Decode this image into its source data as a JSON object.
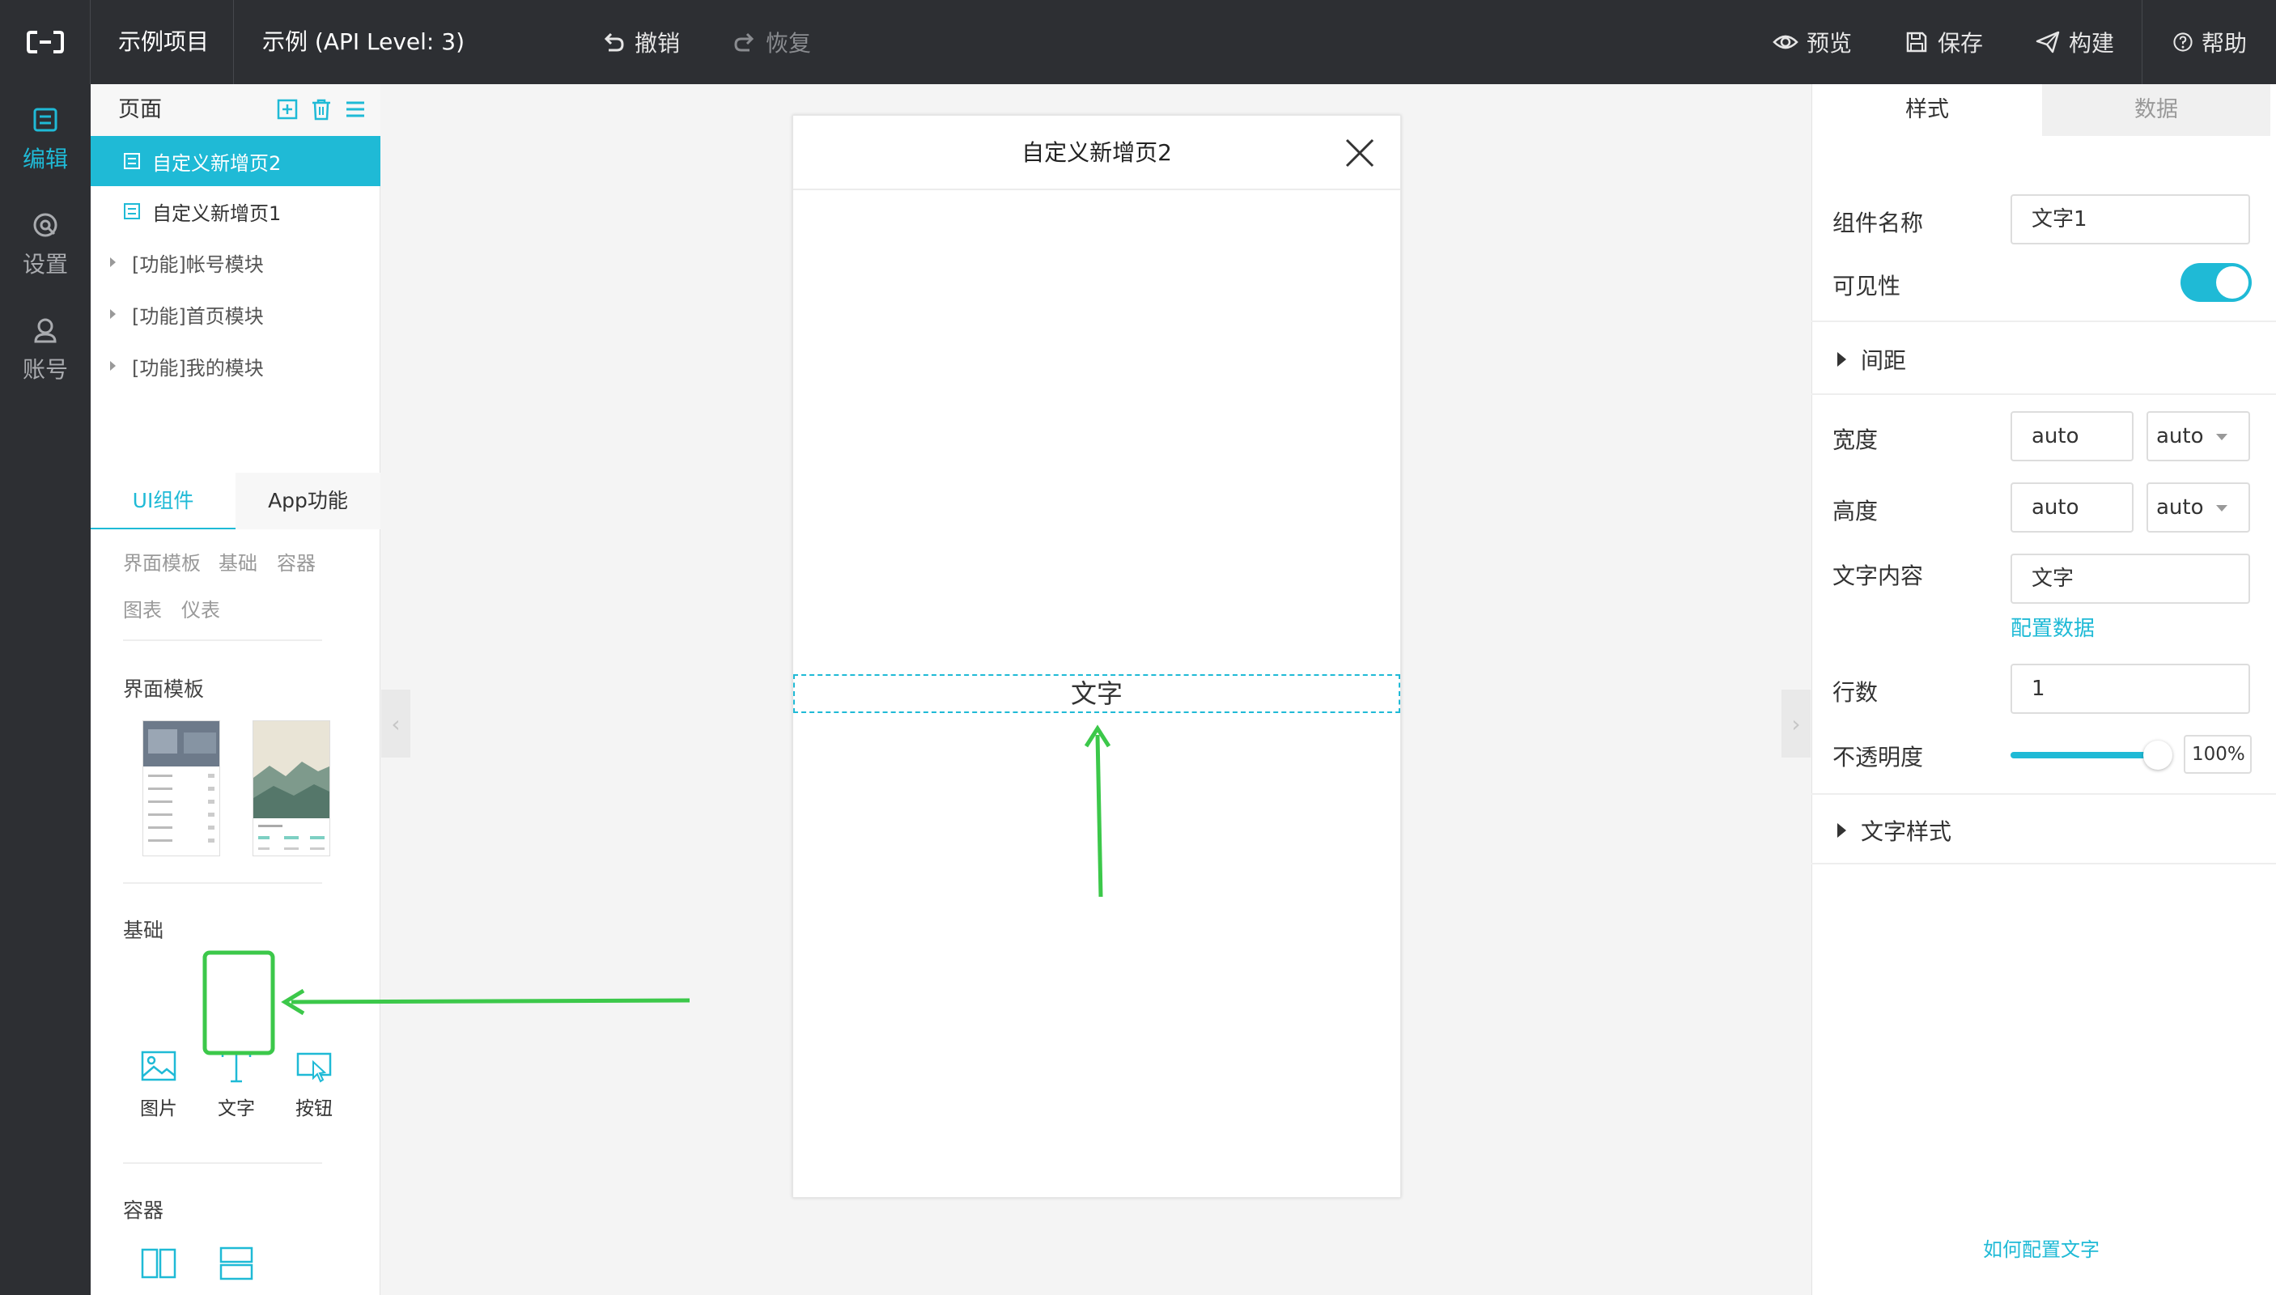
{
  "topbar": {
    "project_name": "示例项目",
    "app_name": "示例 (API Level: 3)",
    "undo": "撤销",
    "redo": "恢复",
    "preview": "预览",
    "save": "保存",
    "build": "构建",
    "help": "帮助"
  },
  "leftnav": {
    "items": [
      {
        "label": "编辑",
        "icon": "edit-icon",
        "active": true
      },
      {
        "label": "设置",
        "icon": "settings-icon",
        "active": false
      },
      {
        "label": "账号",
        "icon": "account-icon",
        "active": false
      }
    ]
  },
  "pages": {
    "title": "页面",
    "items": [
      "自定义新增页2",
      "自定义新增页1"
    ],
    "modules": [
      "[功能]帐号模块",
      "[功能]首页模块",
      "[功能]我的模块"
    ]
  },
  "components": {
    "tabs": [
      "UI组件",
      "App功能"
    ],
    "categories": [
      "界面模板",
      "基础",
      "容器",
      "图表",
      "仪表"
    ],
    "sections": {
      "templates": "界面模板",
      "basic": "基础",
      "container": "容器"
    },
    "basic_items": [
      "图片",
      "文字",
      "按钮"
    ],
    "container_items": [
      "横向",
      "纵向"
    ]
  },
  "canvas": {
    "page_title": "自定义新增页2",
    "text_component": "文字"
  },
  "properties": {
    "tabs": [
      "样式",
      "数据"
    ],
    "component_name_label": "组件名称",
    "component_name_value": "文字1",
    "visibility_label": "可见性",
    "visibility_on": true,
    "spacing_label": "间距",
    "width_label": "宽度",
    "width_value": "auto",
    "width_unit": "auto",
    "height_label": "高度",
    "height_value": "auto",
    "height_unit": "auto",
    "text_content_label": "文字内容",
    "text_content_value": "文字",
    "config_data_link": "配置数据",
    "lines_label": "行数",
    "lines_value": "1",
    "opacity_label": "不透明度",
    "opacity_value": "100%",
    "opacity_fraction": 1.0,
    "text_style_label": "文字样式",
    "help_link": "如何配置文字"
  },
  "colors": {
    "accent": "#1fbad6",
    "topbar": "#2d2f33",
    "annotation": "#3cc84a"
  }
}
